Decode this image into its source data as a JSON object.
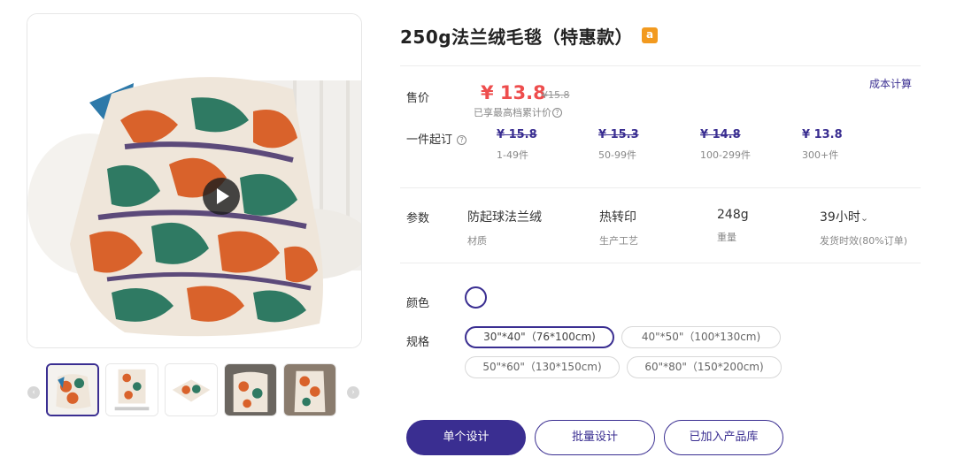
{
  "product": {
    "title": "250g法兰绒毛毯（特惠款）",
    "marketplace_icon": "amazon-icon",
    "marketplace_glyph": "a"
  },
  "price": {
    "label": "售价",
    "current": "¥ 13.8",
    "original": "¥15.8",
    "note": "已享最高档累计价",
    "cost_calc_link": "成本计算"
  },
  "tiers": {
    "label": "一件起订",
    "items": [
      {
        "price": "¥ 15.8",
        "range": "1-49件"
      },
      {
        "price": "¥ 15.3",
        "range": "50-99件"
      },
      {
        "price": "¥ 14.8",
        "range": "100-299件"
      },
      {
        "price": "¥ 13.8",
        "range": "300+件"
      }
    ]
  },
  "params": {
    "label": "参数",
    "items": [
      {
        "value": "防起球法兰绒",
        "name": "材质"
      },
      {
        "value": "热转印",
        "name": "生产工艺"
      },
      {
        "value": "248g",
        "name": "重量"
      },
      {
        "value": "39小时",
        "name": "发货时效(80%订单)",
        "dropdown": "⌄"
      }
    ]
  },
  "color": {
    "label": "颜色",
    "selected_swatch": "#ffffff"
  },
  "sizes": {
    "label": "规格",
    "options": [
      {
        "text": "30\"*40\"（76*100cm)",
        "selected": true
      },
      {
        "text": "40\"*50\"（100*130cm)",
        "selected": false
      },
      {
        "text": "50\"*60\"（130*150cm)",
        "selected": false
      },
      {
        "text": "60\"*80\"（150*200cm)",
        "selected": false
      }
    ]
  },
  "actions": {
    "single_design": "单个设计",
    "batch_design": "批量设计",
    "added_to_library": "已加入产品库"
  },
  "gallery": {
    "prev_icon": "chevron-left-icon",
    "next_icon": "chevron-right-icon",
    "prev_glyph": "‹",
    "next_glyph": "›",
    "play_icon": "play-icon",
    "thumbnail_count": 5,
    "active_thumbnail": 0
  },
  "colors": {
    "accent": "#3a2e91",
    "price_red": "#ee4d4d",
    "amazon_orange": "#f29a1f",
    "blanket_orange": "#d9622b",
    "blanket_green": "#2f7a63",
    "blanket_cream": "#efe6da"
  }
}
